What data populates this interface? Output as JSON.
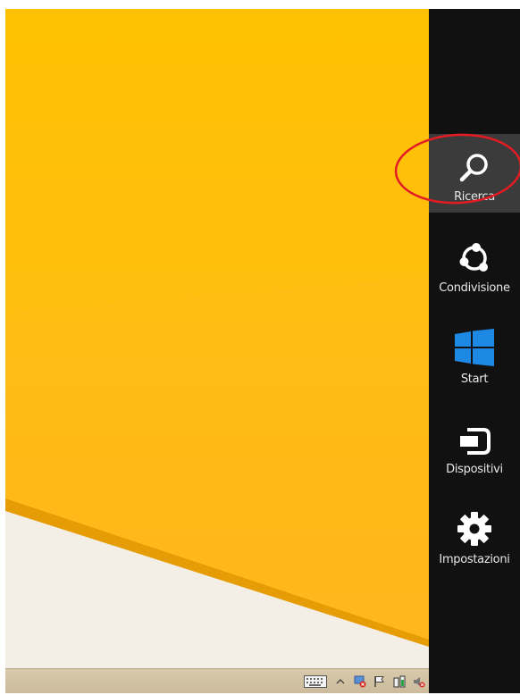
{
  "charms_bar": {
    "items": [
      {
        "label": "Ricerca",
        "icon": "search-icon",
        "selected": true
      },
      {
        "label": "Condivisione",
        "icon": "share-icon",
        "selected": false
      },
      {
        "label": "Start",
        "icon": "windows-logo-icon",
        "selected": false
      },
      {
        "label": "Dispositivi",
        "icon": "devices-icon",
        "selected": false
      },
      {
        "label": "Impostazioni",
        "icon": "settings-gear-icon",
        "selected": false
      }
    ]
  },
  "taskbar": {
    "tray_icons": [
      "keyboard-icon",
      "show-hidden-icons-chevron",
      "network-error-icon",
      "action-center-flag-icon",
      "power-icon",
      "volume-muted-icon"
    ]
  },
  "colors": {
    "wallpaper": "#ffbd12",
    "charms_background": "#111111",
    "charm_selected": "#3b3b3b",
    "windows_blue": "#1e88e5",
    "annotation": "#e31b23"
  }
}
